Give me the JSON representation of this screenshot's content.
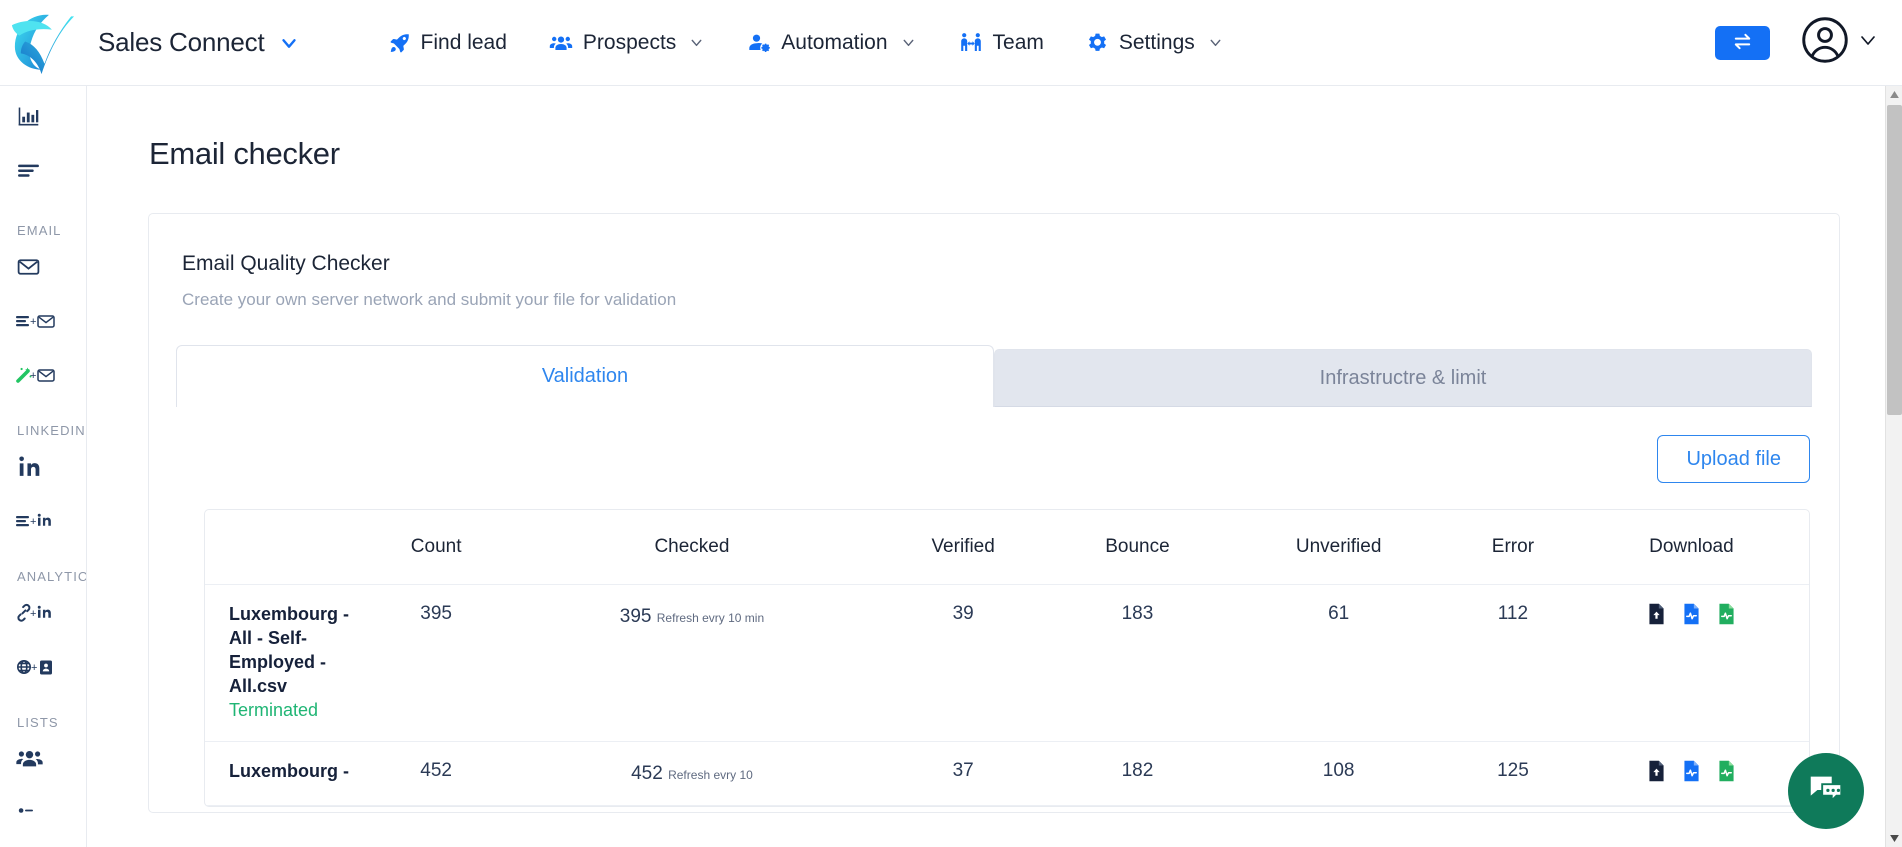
{
  "brand": {
    "name": "Sales Connect",
    "logo_icon": "leaf-check-logo",
    "dropdown_icon": "chevron-down-icon"
  },
  "topnav": {
    "items": [
      {
        "label": "Find lead",
        "icon": "rocket-icon",
        "caret": false
      },
      {
        "label": "Prospects",
        "icon": "people-group-icon",
        "caret": true
      },
      {
        "label": "Automation",
        "icon": "person-gear-icon",
        "caret": true
      },
      {
        "label": "Team",
        "icon": "team-handshake-icon",
        "caret": false
      },
      {
        "label": "Settings",
        "icon": "gear-icon",
        "caret": true
      }
    ],
    "swap_button_icon": "swap-arrows-icon",
    "avatar_icon": "user-circle-icon",
    "avatar_caret_icon": "chevron-down-icon",
    "accent_color": "#1470f5"
  },
  "sidebar": {
    "items": [
      {
        "type": "icon",
        "icon": "bar-chart-icon"
      },
      {
        "type": "icon",
        "icon": "list-lines-icon"
      },
      {
        "type": "section",
        "label": "EMAIL"
      },
      {
        "type": "icon",
        "icon": "open-envelope-icon"
      },
      {
        "type": "icon",
        "icon": "list-plus-envelope-icon"
      },
      {
        "type": "icon",
        "icon": "magic-wand-plus-envelope-icon"
      },
      {
        "type": "section",
        "label": "LINKEDIN"
      },
      {
        "type": "icon",
        "icon": "linkedin-in-icon"
      },
      {
        "type": "icon",
        "icon": "list-plus-linkedin-icon"
      },
      {
        "type": "section",
        "label": "ANALYTICS"
      },
      {
        "type": "icon",
        "icon": "link-plus-linkedin-icon"
      },
      {
        "type": "icon",
        "icon": "globe-plus-contact-card-icon"
      },
      {
        "type": "section",
        "label": "LISTS"
      },
      {
        "type": "icon",
        "icon": "people-group-icon"
      },
      {
        "type": "icon",
        "icon": "person-partial-icon"
      }
    ]
  },
  "main": {
    "page_title": "Email checker",
    "card": {
      "title": "Email Quality Checker",
      "subtitle": "Create your own server network and submit your file for validation",
      "tabs": [
        {
          "label": "Validation",
          "active": true
        },
        {
          "label": "Infrastructre & limit",
          "active": false
        }
      ],
      "upload_button": "Upload file",
      "table": {
        "columns": [
          "",
          "Count",
          "Checked",
          "Verified",
          "Bounce",
          "Unverified",
          "Error",
          "Download"
        ],
        "rows": [
          {
            "name": "Luxembourg - All - Self-Employed - All.csv",
            "status": "Terminated",
            "count": "395",
            "checked": "395",
            "checked_note": "Refresh evry 10 min",
            "verified": "39",
            "bounce": "183",
            "unverified": "61",
            "error": "112",
            "downloads": [
              "file-upload-icon",
              "file-pulse-blue-icon",
              "file-pulse-green-icon"
            ]
          },
          {
            "name": "Luxembourg -",
            "status": "",
            "count": "452",
            "checked": "452",
            "checked_note": "Refresh evry 10",
            "verified": "37",
            "bounce": "182",
            "unverified": "108",
            "error": "125",
            "downloads": [
              "file-upload-icon",
              "file-pulse-blue-icon",
              "file-pulse-green-icon"
            ]
          }
        ]
      }
    }
  },
  "chat": {
    "icon": "chat-bubbles-icon",
    "color": "#0f7a5a"
  },
  "scrollbar": {
    "up_icon": "scroll-up-arrow",
    "down_icon": "scroll-down-arrow"
  },
  "colors": {
    "accent_blue": "#1470f5",
    "tab_blue": "#2e86ee",
    "status_green": "#1fb574",
    "text_dark": "#1c2536",
    "text_muted": "#9aa4b6"
  }
}
